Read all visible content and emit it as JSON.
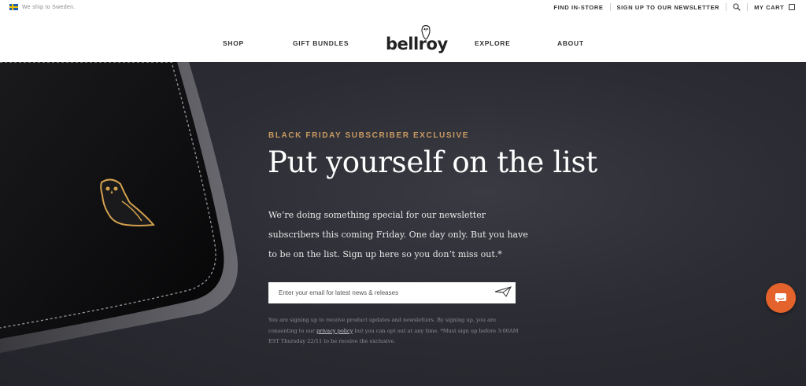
{
  "topbar": {
    "ship_text": "We ship to Sweden.",
    "find_in_store": "FIND IN-STORE",
    "signup": "SIGN UP TO OUR NEWSLETTER",
    "cart": "MY CART"
  },
  "nav": {
    "items": [
      "SHOP",
      "GIFT BUNDLES",
      "EXPLORE",
      "ABOUT"
    ],
    "logo_text": "bellroy"
  },
  "hero": {
    "eyebrow": "BLACK FRIDAY SUBSCRIBER EXCLUSIVE",
    "headline": "Put yourself on the list",
    "body": "We’re doing something special for our newsletter subscribers this coming Friday. One day only. But you have to be on the list. Sign up here so you don’t miss out.*",
    "email_placeholder": "Enter your email for latest news & releases",
    "fine_print_pre": "You are signing up to receive product updates and newsletters. By signing up, you are consenting to our ",
    "privacy_link": "privacy policy",
    "fine_print_post": " but you can opt out at any time. *Must sign up before 3:00AM EST Thursday 22/11 to be receive the exclusive."
  },
  "colors": {
    "accent_gold": "#c99a62",
    "hero_bg": "#2c2d34",
    "chat_orange": "#e4622b"
  },
  "icons": [
    "sweden-flag-icon",
    "search-icon",
    "cart-icon",
    "owl-logo-icon",
    "paper-plane-icon",
    "chat-icon"
  ]
}
